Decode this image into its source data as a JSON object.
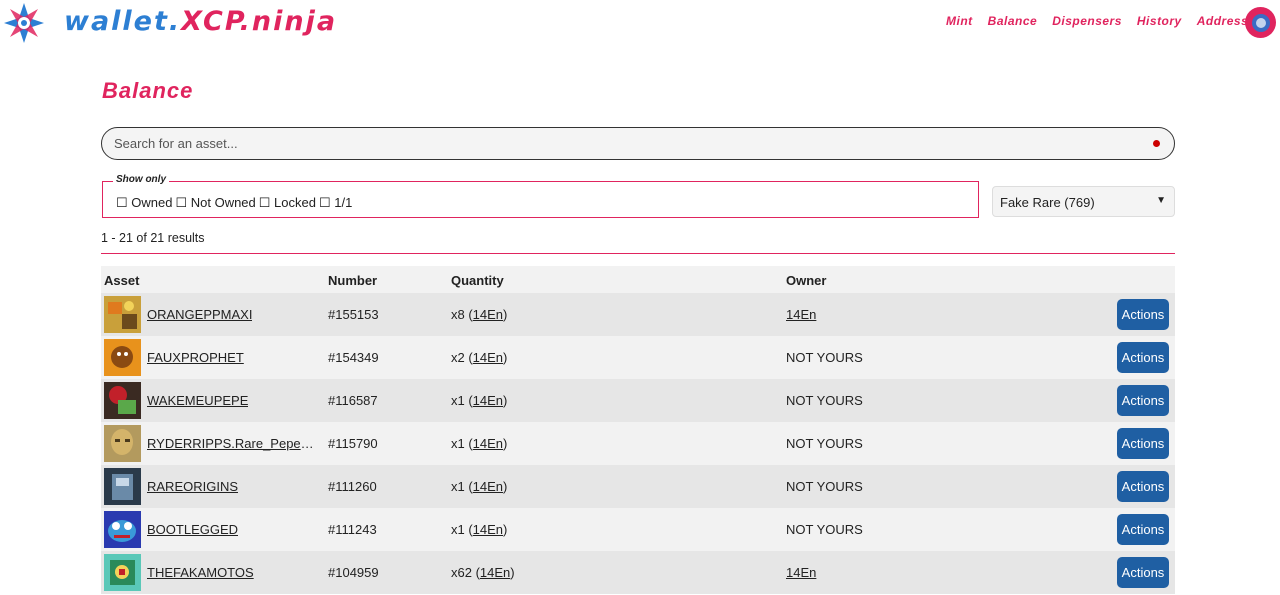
{
  "brand": {
    "part1": "wallet.",
    "part2": "XCP.ninja"
  },
  "nav": {
    "mint": "Mint",
    "balance": "Balance",
    "dispensers": "Dispensers",
    "history": "History",
    "addresses": "Addresses"
  },
  "page": {
    "title": "Balance"
  },
  "search": {
    "placeholder": "Search for an asset..."
  },
  "filter": {
    "legend": "Show only",
    "owned": "☐ Owned",
    "not_owned": "☐ Not Owned",
    "locked": "☐ Locked",
    "one_of_one": "☐ 1/1"
  },
  "collection_select": {
    "selected": "Fake Rare (769)"
  },
  "results": {
    "text": "1 - 21 of 21 results"
  },
  "table": {
    "headers": {
      "asset": "Asset",
      "number": "Number",
      "quantity": "Quantity",
      "owner": "Owner"
    },
    "actions_label": "Actions",
    "rows": [
      {
        "asset": "ORANGEPPMAXI",
        "number": "#155153",
        "qty_prefix": "x8 (",
        "qty_link": "14En",
        "qty_suffix": ")",
        "owner": "14En",
        "owner_link": true
      },
      {
        "asset": "FAUXPROPHET",
        "number": "#154349",
        "qty_prefix": "x2 (",
        "qty_link": "14En",
        "qty_suffix": ")",
        "owner": "NOT YOURS",
        "owner_link": false
      },
      {
        "asset": "WAKEMEUPEPE",
        "number": "#116587",
        "qty_prefix": "x1 (",
        "qty_link": "14En",
        "qty_suffix": ")",
        "owner": "NOT YOURS",
        "owner_link": false
      },
      {
        "asset": "RYDERRIPPS.Rare_Pepe_...",
        "number": "#115790",
        "qty_prefix": "x1 (",
        "qty_link": "14En",
        "qty_suffix": ")",
        "owner": "NOT YOURS",
        "owner_link": false
      },
      {
        "asset": "RAREORIGINS",
        "number": "#111260",
        "qty_prefix": "x1 (",
        "qty_link": "14En",
        "qty_suffix": ")",
        "owner": "NOT YOURS",
        "owner_link": false
      },
      {
        "asset": "BOOTLEGGED",
        "number": "#111243",
        "qty_prefix": "x1 (",
        "qty_link": "14En",
        "qty_suffix": ")",
        "owner": "NOT YOURS",
        "owner_link": false
      },
      {
        "asset": "THEFAKAMOTOS",
        "number": "#104959",
        "qty_prefix": "x62 (",
        "qty_link": "14En",
        "qty_suffix": ")",
        "owner": "14En",
        "owner_link": true
      }
    ]
  },
  "colors": {
    "accent": "#e0245e",
    "brand_blue": "#2d7fd3",
    "button": "#1f5fa3"
  }
}
